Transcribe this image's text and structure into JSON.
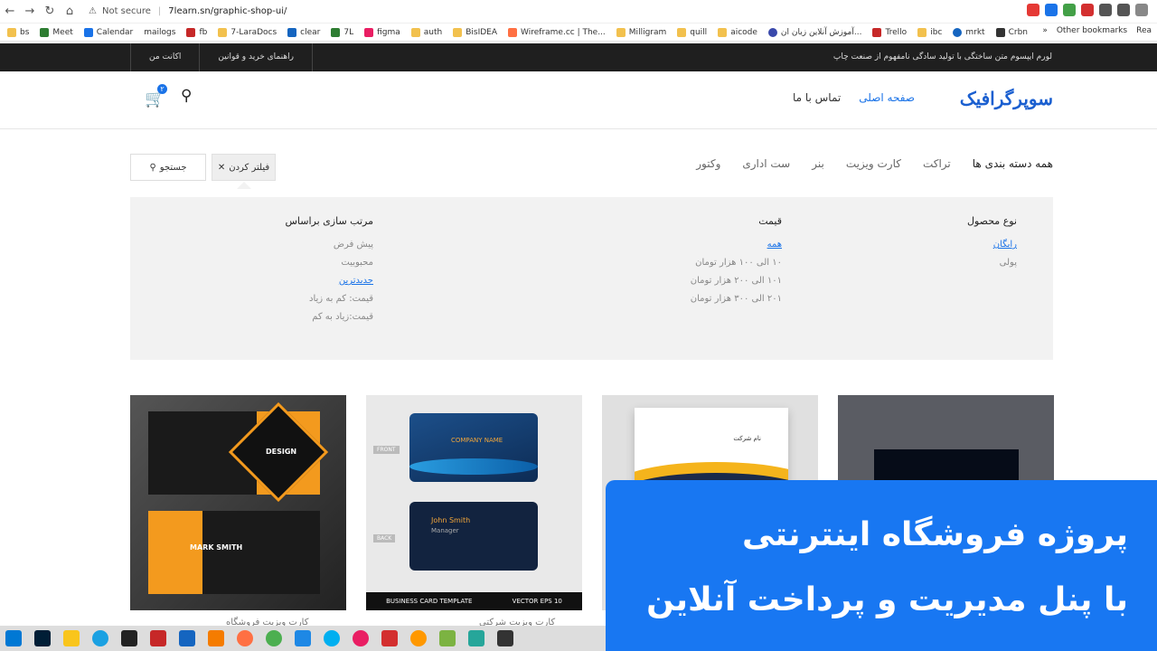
{
  "browser": {
    "security": "Not secure",
    "url": "7learn.sn/graphic-shop-ui/"
  },
  "bookmarks": [
    "bs",
    "Meet",
    "Calendar",
    "mailogs",
    "fb",
    "7-LaraDocs",
    "clear",
    "7L",
    "figma",
    "auth",
    "BisIDEA",
    "Wireframe.cc | The...",
    "Milligram",
    "quill",
    "aicode",
    "آموزش آنلاین زبان ان...",
    "Trello",
    "ibc",
    "mrkt",
    "Crbn"
  ],
  "bookmarks_more": "»",
  "bookmarks_other": "Other bookmarks",
  "bookmarks_reading": "Rea",
  "topbar": {
    "account": "اکانت من",
    "guide": "راهنمای خرید و قوانین",
    "promo": "لورم ایپسوم متن ساختگی با تولید سادگی نامفهوم از صنعت چاپ"
  },
  "header": {
    "logo": "سوپرگرافیک",
    "nav": [
      "صفحه اصلی",
      "تماس با ما"
    ],
    "cart_count": "۲"
  },
  "categories": [
    "همه دسته بندی ها",
    "تراکت",
    "کارت ویزیت",
    "بنر",
    "ست اداری",
    "وکتور"
  ],
  "filter_label": "فیلتر کردن",
  "search_label": "جستجو",
  "filters": {
    "type": {
      "title": "نوع محصول",
      "options": [
        "رایگان",
        "پولی"
      ]
    },
    "price": {
      "title": "قیمت",
      "options": [
        "همه",
        "۱۰ الی ۱۰۰ هزار تومان",
        "۱۰۱ الی ۲۰۰ هزار تومان",
        "۲۰۱ الی ۳۰۰ هزار تومان"
      ]
    },
    "sort": {
      "title": "مرتب سازی براساس",
      "options": [
        "پیش فرض",
        "محبوبیت",
        "جدیدترین",
        "قیمت: کم به زیاد",
        "قیمت:زیاد به کم"
      ]
    }
  },
  "products": {
    "card1": {
      "design": "DESIGN",
      "name": "MARK SMITH",
      "label": "کارت ویزیت فروشگاه"
    },
    "card2": {
      "company": "COMPANY NAME",
      "person": "John Smith",
      "role": "Manager",
      "front": "FRONT",
      "back": "BACK",
      "footer_left": "BUSINESS CARD TEMPLATE",
      "footer_right": "VECTOR EPS 10",
      "label": "کارت ویزیت شرکتی"
    },
    "card3": {
      "company": "نام شرکت"
    }
  },
  "banner": {
    "line1": "پروژه فروشگاه اینترنتی",
    "line2": "با پنل مدیریت و پرداخت آنلاین"
  }
}
